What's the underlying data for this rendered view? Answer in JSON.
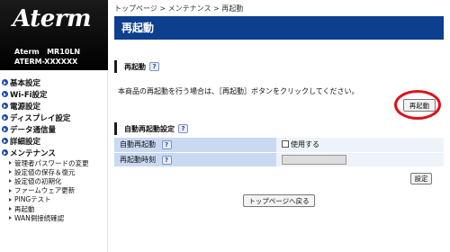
{
  "brand": {
    "logo_text": "Aterm",
    "model_line1": "Aterm   MR10LN",
    "model_line2": "ATERM-XXXXXX"
  },
  "nav": {
    "items": [
      {
        "label": "基本設定"
      },
      {
        "label": "Wi-Fi設定"
      },
      {
        "label": "電源設定"
      },
      {
        "label": "ディスプレイ設定"
      },
      {
        "label": "データ通信量"
      },
      {
        "label": "詳細設定"
      },
      {
        "label": "メンテナンス"
      }
    ],
    "sub_items": [
      {
        "label": "管理者パスワードの変更"
      },
      {
        "label": "設定値の保存＆復元"
      },
      {
        "label": "設定値の初期化"
      },
      {
        "label": "ファームウェア更新"
      },
      {
        "label": "PINGテスト"
      },
      {
        "label": "再起動"
      },
      {
        "label": "WAN側接続確認"
      }
    ]
  },
  "breadcrumb": "トップページ > メンテナンス > 再起動",
  "page_title": "再起動",
  "restart_section": {
    "title": "再起動",
    "help": "?",
    "description": "本商品の再起動を行う場合は、［再起動］ボタンをクリックしてください。",
    "button_label": "再起動"
  },
  "auto_section": {
    "title": "自動再起動設定",
    "help": "?",
    "rows": {
      "auto_restart_label": "自動再起動",
      "auto_restart_help": "?",
      "checkbox_label": "使用する",
      "checkbox_checked": false,
      "time_label": "再起動時刻",
      "time_help": "?"
    },
    "set_button_label": "設定"
  },
  "back_button_label": "トップページへ戻る",
  "colors": {
    "title_bar": "#0d3f8f",
    "highlight_circle": "#e0101c",
    "nav_bullet": "#1b4aa6",
    "table_label_bg": "#c9d9f2"
  }
}
